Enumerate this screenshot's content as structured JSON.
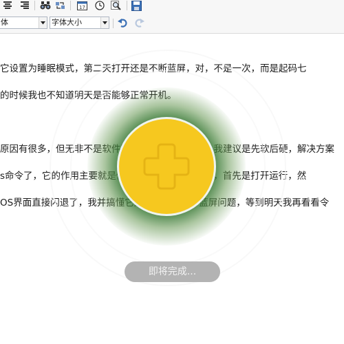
{
  "toolbar": {
    "icons": [
      "align-center-icon",
      "align-right-icon",
      "find-icon",
      "replace-icon",
      "insert-date-icon",
      "insert-time-icon",
      "zoom-icon",
      "save-icon"
    ],
    "font_select": {
      "value": "体"
    },
    "size_select": {
      "value": "字体大小"
    },
    "undo_icon": "undo-icon",
    "redo_icon": "redo-icon",
    "colors": {
      "icon_blue": "#3a6fb5",
      "icon_dark": "#333333"
    }
  },
  "document": {
    "lines": [
      "它设置为睡眠模式，第二天打开还是不断蓝屏，对，不是一次，而是起码七",
      "的时候我也不知道明天是否能够正常开机。",
      "原因有很多，但无非不是软件冲突或者是硬件冲突，我建议是先软后硬，解决方案",
      "s命令了，它的作用主要就是修复Windows系统文件，首先是打开运行，然",
      "OS界面直接闪退了，我并搞懂它是不是修复好了蓝屏问题，等到明天我再看看令"
    ]
  },
  "overlay": {
    "center_icon": "plus-icon",
    "status_label": "即将完成...",
    "colors": {
      "ball": "#f6c81f",
      "glow": "#2f7a2f",
      "pill": "#b3b3b3"
    }
  }
}
